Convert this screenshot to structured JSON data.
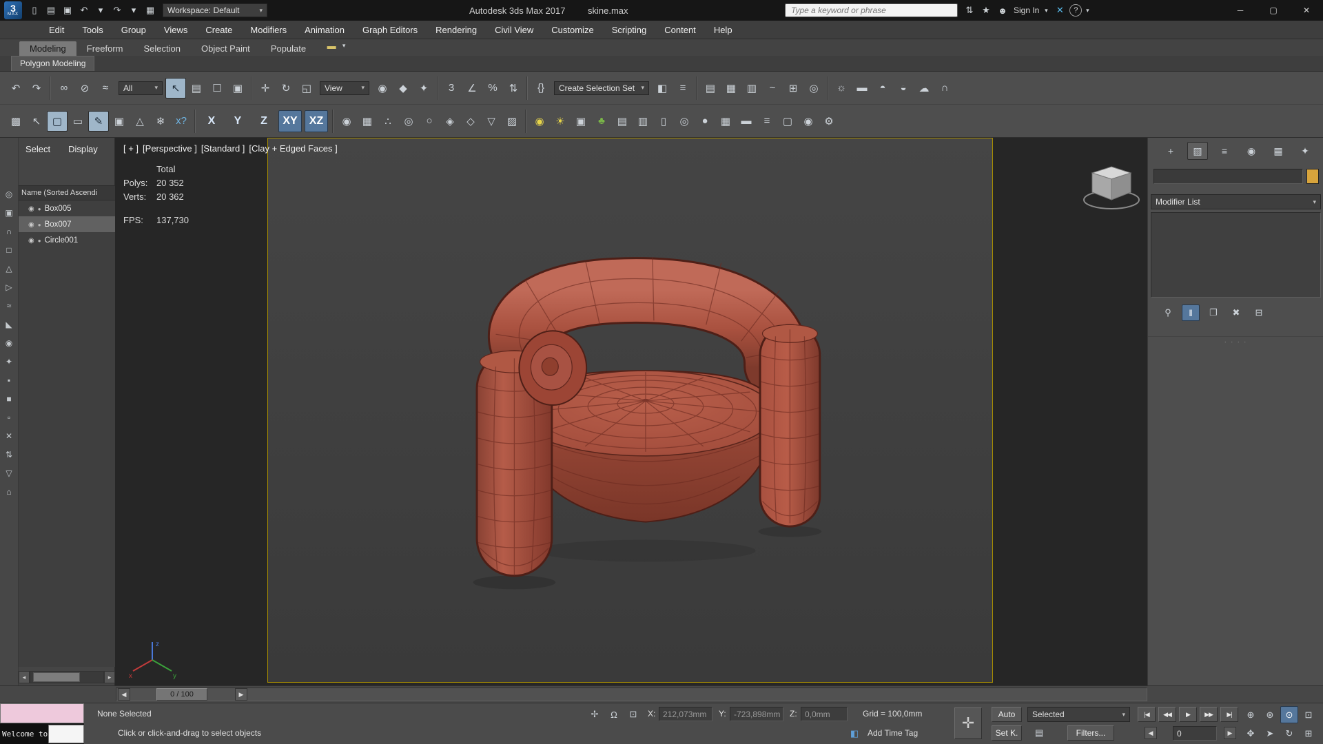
{
  "colors": {
    "accent": "#4d82b8",
    "model": "#a85043",
    "wire": "#5c241c",
    "safe-border": "#a98f00",
    "swatch": "#d8a43c"
  },
  "titlebar": {
    "logo": "3",
    "logo_sub": "MAX",
    "app_title": "Autodesk 3ds Max 2017",
    "file_name": "skine.max",
    "workspace": "Workspace: Default",
    "search_placeholder": "Type a keyword or phrase",
    "sign_in": "Sign In",
    "quick_access": [
      {
        "name": "new-scene-icon",
        "glyph": "▯"
      },
      {
        "name": "open-file-icon",
        "glyph": "▤"
      },
      {
        "name": "save-file-icon",
        "glyph": "▣"
      },
      {
        "name": "undo-icon",
        "glyph": "↶"
      },
      {
        "name": "undo-dropdown-icon",
        "glyph": "▾",
        "caret": true
      },
      {
        "name": "redo-icon",
        "glyph": "↷"
      },
      {
        "name": "redo-dropdown-icon",
        "glyph": "▾",
        "caret": true
      },
      {
        "name": "project-folder-icon",
        "glyph": "▦"
      }
    ],
    "right_icons": [
      {
        "name": "sync-icon",
        "glyph": "⇅"
      },
      {
        "name": "favorites-icon",
        "glyph": "★"
      },
      {
        "name": "user-icon",
        "glyph": "☻"
      }
    ],
    "x_app_glyph": "✕",
    "help_glyph": "?",
    "window": {
      "minimize": "─",
      "maximize": "▢",
      "close": "✕"
    }
  },
  "menubar": {
    "items": [
      {
        "name": "menu-edit",
        "label": "Edit"
      },
      {
        "name": "menu-tools",
        "label": "Tools"
      },
      {
        "name": "menu-group",
        "label": "Group"
      },
      {
        "name": "menu-views",
        "label": "Views"
      },
      {
        "name": "menu-create",
        "label": "Create"
      },
      {
        "name": "menu-modifiers",
        "label": "Modifiers"
      },
      {
        "name": "menu-animation",
        "label": "Animation"
      },
      {
        "name": "menu-graph-editors",
        "label": "Graph Editors"
      },
      {
        "name": "menu-rendering",
        "label": "Rendering"
      },
      {
        "name": "menu-civil-view",
        "label": "Civil View"
      },
      {
        "name": "menu-customize",
        "label": "Customize"
      },
      {
        "name": "menu-scripting",
        "label": "Scripting"
      },
      {
        "name": "menu-content",
        "label": "Content"
      },
      {
        "name": "menu-help",
        "label": "Help"
      }
    ]
  },
  "ribbon": {
    "tabs": [
      {
        "name": "ribbon-tab-modeling",
        "label": "Modeling",
        "active": true
      },
      {
        "name": "ribbon-tab-freeform",
        "label": "Freeform"
      },
      {
        "name": "ribbon-tab-selection",
        "label": "Selection"
      },
      {
        "name": "ribbon-tab-object-paint",
        "label": "Object Paint"
      },
      {
        "name": "ribbon-tab-populate",
        "label": "Populate"
      }
    ],
    "extra_glyph": "▬",
    "panel_button": "Polygon Modeling"
  },
  "toolbar": {
    "filter_value": "All",
    "coord_value": "View",
    "selection_set_placeholder": "Create Selection Set",
    "g_undo": [
      {
        "name": "undo-icon",
        "glyph": "↶"
      },
      {
        "name": "redo-icon",
        "glyph": "↷"
      }
    ],
    "g_link": [
      {
        "name": "select-and-link-icon",
        "glyph": "∞"
      },
      {
        "name": "unlink-selection-icon",
        "glyph": "⊘"
      },
      {
        "name": "bind-to-spacewarp-icon",
        "glyph": "≈"
      }
    ],
    "g_select": [
      {
        "name": "select-object-icon",
        "glyph": "↖",
        "active": true
      },
      {
        "name": "select-by-name-icon",
        "glyph": "▤"
      },
      {
        "name": "rectangular-selection-region-icon",
        "glyph": "☐"
      },
      {
        "name": "window-crossing-icon",
        "glyph": "▣"
      }
    ],
    "g_transform": [
      {
        "name": "select-and-move-icon",
        "glyph": "✛"
      },
      {
        "name": "select-and-rotate-icon",
        "glyph": "↻"
      },
      {
        "name": "select-and-scale-icon",
        "glyph": "◱"
      }
    ],
    "g_pivot": [
      {
        "name": "use-pivot-point-icon",
        "glyph": "◉"
      },
      {
        "name": "select-and-manipulate-icon",
        "glyph": "◆"
      },
      {
        "name": "keyboard-shortcut-override-icon",
        "glyph": "✦"
      }
    ],
    "g_snap": [
      {
        "name": "snaps-toggle-icon",
        "glyph": "3"
      },
      {
        "name": "angle-snap-icon",
        "glyph": "∠"
      },
      {
        "name": "percent-snap-icon",
        "glyph": "%"
      },
      {
        "name": "spinner-snap-icon",
        "glyph": "⇅"
      }
    ],
    "g_sets": [
      {
        "name": "edit-named-selection-sets-icon",
        "glyph": "{}"
      }
    ],
    "g_mirror": [
      {
        "name": "mirror-icon",
        "glyph": "◧"
      },
      {
        "name": "align-icon",
        "glyph": "≡"
      }
    ],
    "g_managers": [
      {
        "name": "toggle-layer-explorer-icon",
        "glyph": "▤"
      },
      {
        "name": "graphite-ribbon-icon",
        "glyph": "▦"
      },
      {
        "name": "toggle-scene-explorer-icon",
        "glyph": "▥"
      },
      {
        "name": "curve-editor-icon",
        "glyph": "~"
      },
      {
        "name": "schematic-view-icon",
        "glyph": "⊞"
      },
      {
        "name": "material-editor-icon",
        "glyph": "◎"
      }
    ],
    "g_render": [
      {
        "name": "render-setup-icon",
        "glyph": "☼"
      },
      {
        "name": "rendered-frame-window-icon",
        "glyph": "▬"
      },
      {
        "name": "render-production-icon",
        "glyph": "◓"
      },
      {
        "name": "render-iterative-icon",
        "glyph": "◒"
      },
      {
        "name": "render-in-cloud-icon",
        "glyph": "☁"
      },
      {
        "name": "open-a360-icon",
        "glyph": "∩"
      }
    ]
  },
  "toolbar2": {
    "left": [
      {
        "name": "grid-dots-icon",
        "glyph": "▩"
      },
      {
        "name": "swift-loop-icon",
        "glyph": "↖"
      },
      {
        "name": "select-region-mode-icon",
        "glyph": "▢",
        "active": true
      },
      {
        "name": "edit-poly-page-icon",
        "glyph": "▭"
      },
      {
        "name": "paint-deform-icon",
        "glyph": "✎",
        "active": true
      },
      {
        "name": "quad-tool-icon",
        "glyph": "▣"
      },
      {
        "name": "prism-tool-icon",
        "glyph": "△"
      },
      {
        "name": "freeze-selection-icon",
        "glyph": "❄"
      },
      {
        "name": "xview-icon",
        "glyph": "x?",
        "c": "#6fb3e0"
      }
    ],
    "axis": [
      {
        "name": "constraint-x-button",
        "label": "X"
      },
      {
        "name": "constraint-y-button",
        "label": "Y"
      },
      {
        "name": "constraint-z-button",
        "label": "Z"
      },
      {
        "name": "constraint-xy-button",
        "label": "XY",
        "active": true
      },
      {
        "name": "constraint-xz-button",
        "label": "XZ",
        "active": true
      }
    ],
    "mid": [
      {
        "name": "soft-selection-icon",
        "glyph": "◉"
      },
      {
        "name": "grid-align-icon",
        "glyph": "▦"
      },
      {
        "name": "dot-loop-icon",
        "glyph": "∴"
      },
      {
        "name": "loop-select-icon",
        "glyph": "◎"
      },
      {
        "name": "ring-select-icon",
        "glyph": "○"
      },
      {
        "name": "grow-selection-icon",
        "glyph": "◈"
      },
      {
        "name": "shrink-selection-icon",
        "glyph": "◇"
      },
      {
        "name": "ignore-backfacing-icon",
        "glyph": "▽"
      },
      {
        "name": "checker-pattern-icon",
        "glyph": "▨"
      }
    ],
    "right": [
      {
        "name": "light-bulb-icon",
        "glyph": "◉",
        "c": "#e6d44a"
      },
      {
        "name": "daylight-icon",
        "glyph": "☀",
        "c": "#e6d44a"
      },
      {
        "name": "camera-icon",
        "glyph": "▣"
      },
      {
        "name": "foliage-icon",
        "glyph": "♣",
        "c": "#7ab648"
      },
      {
        "name": "text-tool-icon",
        "glyph": "▤"
      },
      {
        "name": "building-icon",
        "glyph": "▥"
      },
      {
        "name": "door-icon",
        "glyph": "▯"
      },
      {
        "name": "torus-icon",
        "glyph": "◎"
      },
      {
        "name": "sphere-icon",
        "glyph": "●"
      },
      {
        "name": "grid-helper-icon",
        "glyph": "▦"
      },
      {
        "name": "clapperboard-icon",
        "glyph": "▬"
      },
      {
        "name": "layer-stack-icon",
        "glyph": "≡"
      },
      {
        "name": "monitor-icon",
        "glyph": "▢"
      },
      {
        "name": "eye-icon",
        "glyph": "◉"
      },
      {
        "name": "gear-icon",
        "glyph": "⚙"
      }
    ]
  },
  "explorer": {
    "menus": [
      {
        "name": "explorer-menu-select",
        "label": "Select"
      },
      {
        "name": "explorer-menu-display",
        "label": "Display"
      }
    ],
    "column_header": "Name (Sorted Ascendi",
    "rows": [
      {
        "name": "scene-object-box005",
        "label": "Box005"
      },
      {
        "name": "scene-object-box007",
        "label": "Box007",
        "active": true
      },
      {
        "name": "scene-object-circle001",
        "label": "Circle001"
      }
    ],
    "tools": [
      {
        "name": "explorer-lock-icon",
        "glyph": "◎"
      },
      {
        "name": "explorer-pick-icon",
        "glyph": "▣"
      },
      {
        "name": "display-geometry-icon",
        "glyph": "∩"
      },
      {
        "name": "display-shapes-icon",
        "glyph": "□"
      },
      {
        "name": "display-lights-icon",
        "glyph": "△"
      },
      {
        "name": "display-cameras-icon",
        "glyph": "▷"
      },
      {
        "name": "display-helpers-icon",
        "glyph": "≈"
      },
      {
        "name": "display-spacewarps-icon",
        "glyph": "◣"
      },
      {
        "name": "display-groups-icon",
        "glyph": "◉"
      },
      {
        "name": "display-xrefs-icon",
        "glyph": "✦"
      },
      {
        "name": "display-materials-icon",
        "glyph": "▪"
      },
      {
        "name": "display-bones-icon",
        "glyph": "■"
      },
      {
        "name": "display-frozen-icon",
        "glyph": "▫"
      },
      {
        "name": "display-hidden-icon",
        "glyph": "✕"
      },
      {
        "name": "explorer-sort-icon",
        "glyph": "⇅"
      },
      {
        "name": "explorer-filter-icon",
        "glyph": "▽"
      },
      {
        "name": "explorer-folder-icon",
        "glyph": "⌂"
      }
    ]
  },
  "viewport": {
    "label_segments": [
      {
        "name": "viewport-menu-general",
        "label": "[ + ]"
      },
      {
        "name": "viewport-menu-pov",
        "label": "[Perspective ]"
      },
      {
        "name": "viewport-menu-standard",
        "label": "[Standard ]"
      },
      {
        "name": "viewport-menu-shading",
        "label": "[Clay + Edged Faces ]"
      }
    ],
    "stats": {
      "total": "Total",
      "polys_label": "Polys:",
      "polys": "20 352",
      "verts_label": "Verts:",
      "verts": "20 362",
      "fps_label": "FPS:",
      "fps": "137,730"
    },
    "axis": {
      "x": "x",
      "y": "y",
      "z": "z"
    }
  },
  "command_panel": {
    "tabs": [
      {
        "name": "create-tab-icon",
        "glyph": "+"
      },
      {
        "name": "modify-tab-icon",
        "glyph": "▨",
        "active": true
      },
      {
        "name": "hierarchy-tab-icon",
        "glyph": "≡"
      },
      {
        "name": "motion-tab-icon",
        "glyph": "◉"
      },
      {
        "name": "display-tab-icon",
        "glyph": "▦"
      },
      {
        "name": "utilities-tab-icon",
        "glyph": "✦"
      }
    ],
    "object_name_value": "",
    "modifier_list_label": "Modifier List",
    "stack_buttons": [
      {
        "name": "pin-stack-icon",
        "glyph": "⚲"
      },
      {
        "name": "show-end-result-icon",
        "glyph": "‖",
        "active": true
      },
      {
        "name": "make-unique-icon",
        "glyph": "❐"
      },
      {
        "name": "remove-modifier-icon",
        "glyph": "✖"
      },
      {
        "name": "configure-modifier-sets-icon",
        "glyph": "⊟"
      }
    ],
    "grip": "· · · ·"
  },
  "timeline": {
    "thumb_label": "0 / 100",
    "prev_glyph": "◀",
    "next_glyph": "▶"
  },
  "statusbar": {
    "maxscript_text": "Welcome to M",
    "selection_status": "None Selected",
    "prompt": "Click or click-and-drag to select objects",
    "mini_icons": [
      {
        "name": "transform-gizmo-icon",
        "glyph": "✢"
      },
      {
        "name": "selection-lock-icon",
        "glyph": "Ω"
      },
      {
        "name": "absolute-mode-icon",
        "glyph": "⊡"
      }
    ],
    "x_label": "X:",
    "x_value": "212,073mm",
    "y_label": "Y:",
    "y_value": "-723,898mm",
    "z_label": "Z:",
    "z_value": "0,0mm",
    "grid_label": "Grid = 100,0mm",
    "time_tag_glyph": "◧",
    "time_tag_label": "Add Time Tag",
    "set_key_glyph": "✛",
    "auto_key_label": "Auto",
    "set_key_label": "Set K.",
    "key_filter_value": "Selected",
    "key_filters_glyph": "▤",
    "filters_label": "Filters...",
    "frame_value": "0",
    "playback": [
      {
        "name": "go-to-start-icon",
        "glyph": "|◀"
      },
      {
        "name": "previous-frame-icon",
        "glyph": "◀◀"
      },
      {
        "name": "play-animation-icon",
        "glyph": "▶"
      },
      {
        "name": "next-frame-icon",
        "glyph": "▶▶"
      },
      {
        "name": "go-to-end-icon",
        "glyph": "▶|"
      }
    ],
    "frame_back_glyph": "◀",
    "frame_fwd_glyph": "▶",
    "nav": [
      {
        "name": "zoom-icon",
        "glyph": "⊕"
      },
      {
        "name": "zoom-all-icon",
        "glyph": "⊛"
      },
      {
        "name": "zoom-extents-icon",
        "glyph": "⊙",
        "active": true
      },
      {
        "name": "zoom-region-icon",
        "glyph": "⊡"
      },
      {
        "name": "pan-icon",
        "glyph": "✥"
      },
      {
        "name": "walk-through-icon",
        "glyph": "➤"
      },
      {
        "name": "orbit-icon",
        "glyph": "↻"
      },
      {
        "name": "maximize-viewport-toggle-icon",
        "glyph": "⊞"
      }
    ]
  }
}
